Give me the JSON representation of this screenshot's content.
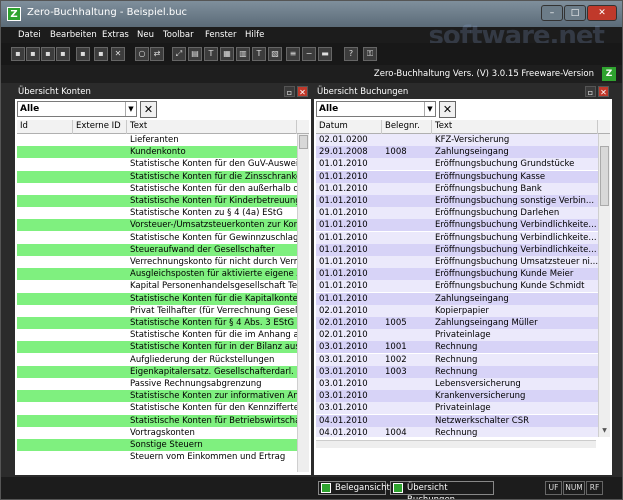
{
  "window": {
    "title": "Zero-Buchhaltung - Beispiel.buc",
    "app_icon": "Z",
    "minimize": "–",
    "maximize": "□",
    "close": "✕"
  },
  "menu": [
    "Datei",
    "Bearbeiten",
    "Extras",
    "Neu",
    "Toolbar",
    "Fenster",
    "Hilfe"
  ],
  "watermark": "software.net",
  "toolbar": {
    "icons": [
      "save-icon",
      "open-icon",
      "export-icon",
      "print-icon",
      "delete-icon",
      "new-icon",
      "transfer-icon",
      "expand-icon",
      "table-icon",
      "text-icon",
      "layout-icon",
      "calendar-icon",
      "tablet-icon",
      "list-icon",
      "image-icon",
      "form-icon",
      "question-icon",
      "key-icon"
    ]
  },
  "version": {
    "text": "Zero-Buchhaltung Vers. (V) 3.0.15 Freeware-Version",
    "icon": "Z"
  },
  "accounts_panel": {
    "title": "Übersicht Konten",
    "filter_value": "Alle",
    "clear_label": "✕",
    "columns": [
      "Id",
      "Externe ID",
      "Text"
    ],
    "rows": [
      {
        "text": "Lieferanten",
        "highlight": false
      },
      {
        "text": "Kundenkonto",
        "highlight": true
      },
      {
        "text": "Statistische Konten für den GuV-Ausweis i",
        "highlight": false
      },
      {
        "text": "Statistische Konten für die Zinsschranke § 4",
        "highlight": true
      },
      {
        "text": "Statistische Konten für den außerhalb der",
        "highlight": false
      },
      {
        "text": "Statistische Konten für Kinderbetreuungsk",
        "highlight": true
      },
      {
        "text": "Statistische Konten zu § 4 (4a) EStG",
        "highlight": false
      },
      {
        "text": "Vorsteuer-/Umsatzsteuerkonten zur Korrek",
        "highlight": true
      },
      {
        "text": "Statistische Konten für Gewinnzuschlag",
        "highlight": false
      },
      {
        "text": "Steueraufwand der Gesellschafter",
        "highlight": true
      },
      {
        "text": "Verrechnungskonto für nicht durch Vermö",
        "highlight": false
      },
      {
        "text": "Ausgleichsposten für aktivierte eigene Ant",
        "highlight": true
      },
      {
        "text": "Kapital Personenhandelsgesellschaft Teilh",
        "highlight": false
      },
      {
        "text": "Statistische Konten für die Kapitalkontene",
        "highlight": true
      },
      {
        "text": "Privat Teilhafter (für Verrechnung Gesellsc",
        "highlight": false
      },
      {
        "text": "Statistische Konten für § 4 Abs. 3 EStG",
        "highlight": true
      },
      {
        "text": "Statistische Konten für die im Anhang anz",
        "highlight": false
      },
      {
        "text": "Statistische Konten für in der Bilanz auszu",
        "highlight": true
      },
      {
        "text": "Aufgliederung der Rückstellungen",
        "highlight": false
      },
      {
        "text": "Eigenkapitalersatz. Gesellschafterdarl.",
        "highlight": true
      },
      {
        "text": "Passive Rechnungsabgrenzung",
        "highlight": false
      },
      {
        "text": "Statistische Konten zur informativen Anga",
        "highlight": true
      },
      {
        "text": "Statistische Konten für den Kennzifferteil",
        "highlight": false
      },
      {
        "text": "Statistische Konten für Betriebswirtschaftli",
        "highlight": true
      },
      {
        "text": "Vortragskonten",
        "highlight": false
      },
      {
        "text": "Sonstige Steuern",
        "highlight": true
      },
      {
        "text": "Steuern vom Einkommen und Ertrag",
        "highlight": false
      }
    ]
  },
  "bookings_panel": {
    "title": "Übersicht Buchungen",
    "filter_value": "Alle",
    "clear_label": "✕",
    "columns": [
      "Datum",
      "Belegnr.",
      "Text"
    ],
    "rows": [
      {
        "date": "02.01.0200",
        "doc": "",
        "text": "KFZ-Versicherung",
        "highlight": false
      },
      {
        "date": "29.01.2008",
        "doc": "1008",
        "text": "Zahlungseingang",
        "highlight": true
      },
      {
        "date": "01.01.2010",
        "doc": "",
        "text": "Eröffnungsbuchung Grundstücke",
        "highlight": false
      },
      {
        "date": "01.01.2010",
        "doc": "",
        "text": "Eröffnungsbuchung Kasse",
        "highlight": true
      },
      {
        "date": "01.01.2010",
        "doc": "",
        "text": "Eröffnungsbuchung Bank",
        "highlight": false
      },
      {
        "date": "01.01.2010",
        "doc": "",
        "text": "Eröffnungsbuchung sonstige Verbin...",
        "highlight": true
      },
      {
        "date": "01.01.2010",
        "doc": "",
        "text": "Eröffnungsbuchung Darlehen",
        "highlight": false
      },
      {
        "date": "01.01.2010",
        "doc": "",
        "text": "Eröffnungsbuchung Verbindlichkeite...",
        "highlight": true
      },
      {
        "date": "01.01.2010",
        "doc": "",
        "text": "Eröffnungsbuchung Verbindlichkeite...",
        "highlight": false
      },
      {
        "date": "01.01.2010",
        "doc": "",
        "text": "Eröffnungsbuchung Verbindlichkeite...",
        "highlight": true
      },
      {
        "date": "01.01.2010",
        "doc": "",
        "text": "Eröffnungsbuchung Umsatzsteuer ni...",
        "highlight": false
      },
      {
        "date": "01.01.2010",
        "doc": "",
        "text": "Eröffnungsbuchung Kunde Meier",
        "highlight": true
      },
      {
        "date": "01.01.2010",
        "doc": "",
        "text": "Eröffnungsbuchung  Kunde Schmidt",
        "highlight": false
      },
      {
        "date": "01.01.2010",
        "doc": "",
        "text": "Zahlungseingang",
        "highlight": true
      },
      {
        "date": "02.01.2010",
        "doc": "",
        "text": "Kopierpapier",
        "highlight": false
      },
      {
        "date": "02.01.2010",
        "doc": "1005",
        "text": "Zahlungseingang Müller",
        "highlight": true
      },
      {
        "date": "02.01.2010",
        "doc": "",
        "text": "Privateinlage",
        "highlight": false
      },
      {
        "date": "03.01.2010",
        "doc": "1001",
        "text": "Rechnung",
        "highlight": true
      },
      {
        "date": "03.01.2010",
        "doc": "1002",
        "text": "Rechnung",
        "highlight": false
      },
      {
        "date": "03.01.2010",
        "doc": "1003",
        "text": "Rechnung",
        "highlight": true
      },
      {
        "date": "03.01.2010",
        "doc": "",
        "text": "Lebensversicherung",
        "highlight": false
      },
      {
        "date": "03.01.2010",
        "doc": "",
        "text": "Krankenversicherung",
        "highlight": true
      },
      {
        "date": "03.01.2010",
        "doc": "",
        "text": "Privateinlage",
        "highlight": false
      },
      {
        "date": "04.01.2010",
        "doc": "",
        "text": "Netzwerkschalter CSR",
        "highlight": true
      },
      {
        "date": "04.01.2010",
        "doc": "1004",
        "text": "Rechnung",
        "highlight": false
      }
    ]
  },
  "bottom_tabs": [
    "Belegansicht",
    "Übersicht Buchungen"
  ],
  "status": [
    "UF",
    "NUM",
    "RF"
  ],
  "colors": {
    "green_row": "#7ff07f",
    "lavender_row": "#d7d3f7",
    "light_lavender_row": "#ebe9fb"
  }
}
